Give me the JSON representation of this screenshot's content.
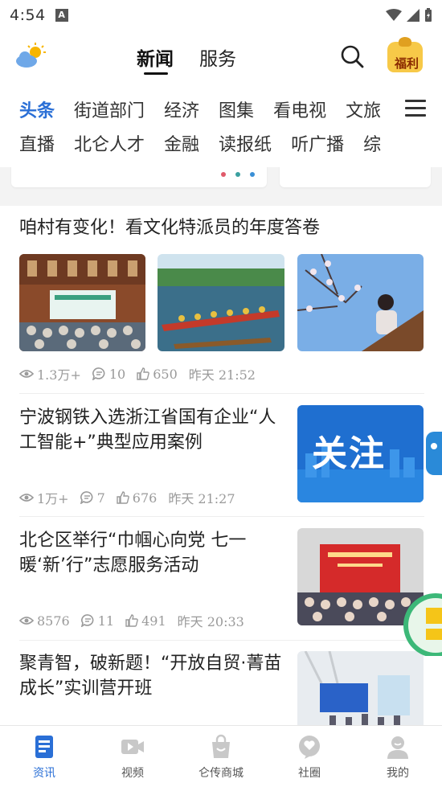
{
  "status_bar": {
    "time": "4:54",
    "badge": "A"
  },
  "header": {
    "tabs": [
      {
        "label": "新闻",
        "active": true
      },
      {
        "label": "服务",
        "active": false
      }
    ],
    "fuli_label": "福利"
  },
  "categories": {
    "row1": [
      "头条",
      "街道部门",
      "经济",
      "图集",
      "看电视",
      "文旅"
    ],
    "row2": [
      "直播",
      "北仑人才",
      "金融",
      "读报纸",
      "听广播",
      "综"
    ],
    "active": "头条"
  },
  "articles": [
    {
      "title": "咱村有变化！看文化特派员的年度答卷",
      "views": "1.3万+",
      "comments": "10",
      "likes": "650",
      "time": "昨天 21:52"
    },
    {
      "title": "宁波钢铁入选浙江省国有企业“人工智能+”典型应用案例",
      "views": "1万+",
      "comments": "7",
      "likes": "676",
      "time": "昨天 21:27",
      "thumb_text": "关注"
    },
    {
      "title": "北仑区举行“巾帼心向党 七一暖‘新’行”志愿服务活动",
      "views": "8576",
      "comments": "11",
      "likes": "491",
      "time": "昨天 20:33"
    },
    {
      "title": "聚青智，破新题！“开放自贸·菁苗成长”实训营开班"
    }
  ],
  "bottom_nav": [
    {
      "label": "资讯",
      "icon": "news-doc-icon",
      "active": true
    },
    {
      "label": "视频",
      "icon": "video-icon",
      "active": false
    },
    {
      "label": "仑传商城",
      "icon": "shopping-bag-icon",
      "active": false
    },
    {
      "label": "社圈",
      "icon": "chat-bubble-icon",
      "active": false
    },
    {
      "label": "我的",
      "icon": "person-icon",
      "active": false
    }
  ],
  "colors": {
    "accent": "#2a6fd6",
    "meta_gray": "#9a9a9a"
  }
}
